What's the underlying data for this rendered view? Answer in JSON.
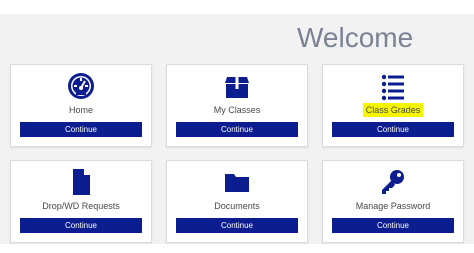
{
  "page": {
    "title": "Welcome"
  },
  "theme": {
    "button_color": "#0b1d8f",
    "icon_color": "#0b1d8f",
    "highlight_color": "#f5f500"
  },
  "cards": [
    {
      "label": "Home",
      "button": "Continue",
      "icon": "dashboard-gauge-icon"
    },
    {
      "label": "My Classes",
      "button": "Continue",
      "icon": "box-icon"
    },
    {
      "label": "Class Grades",
      "button": "Continue",
      "icon": "list-icon",
      "highlighted": true
    },
    {
      "label": "Drop/WD Requests",
      "button": "Continue",
      "icon": "document-icon"
    },
    {
      "label": "Documents",
      "button": "Continue",
      "icon": "folder-icon"
    },
    {
      "label": "Manage Password",
      "button": "Continue",
      "icon": "key-icon"
    }
  ]
}
